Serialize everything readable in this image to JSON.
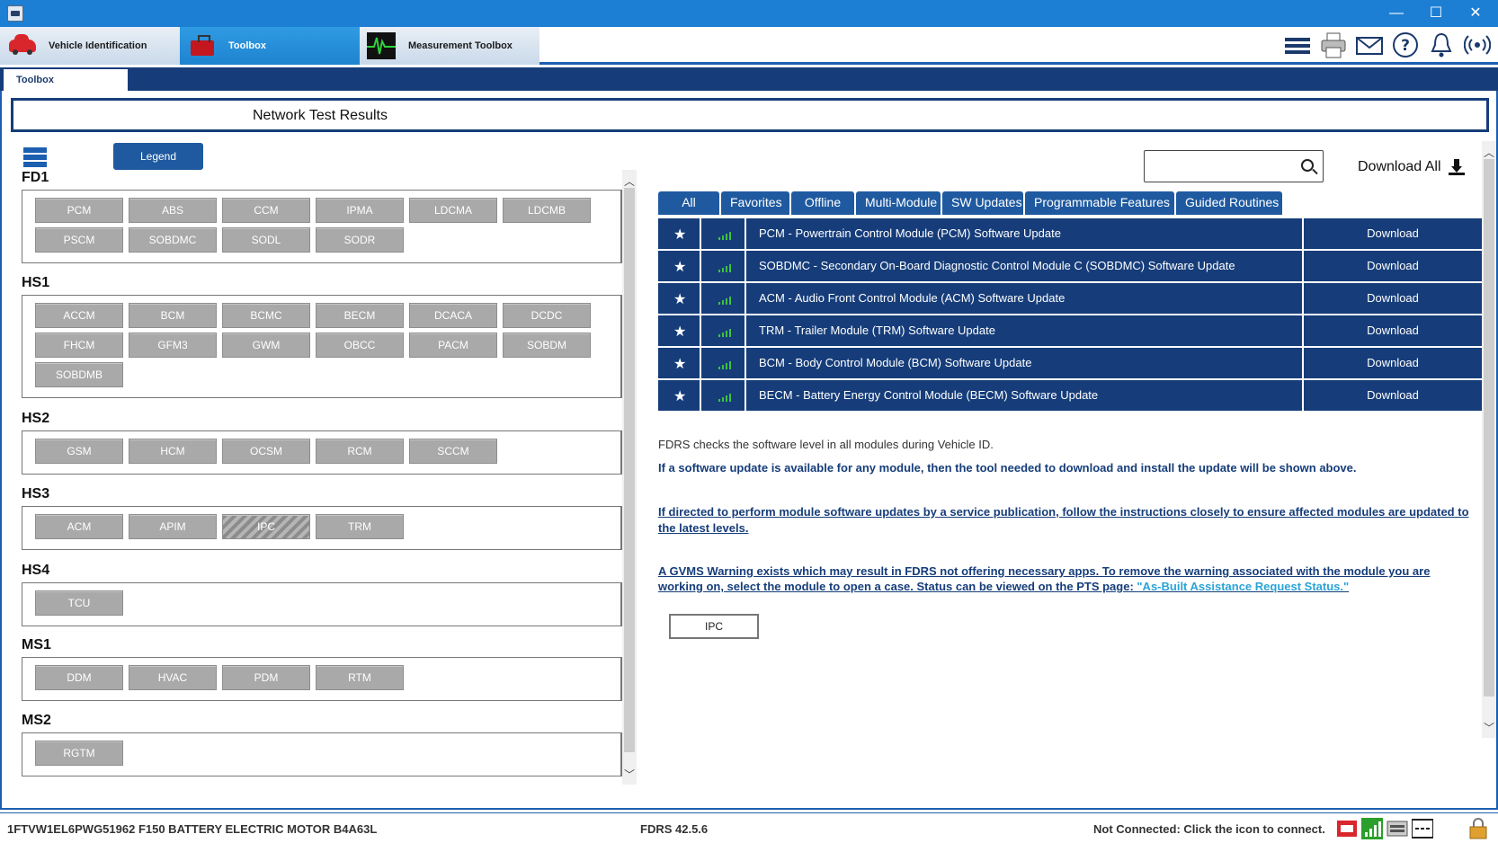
{
  "window": {
    "minimize": "—",
    "maximize": "☐",
    "close": "✕"
  },
  "top_tabs": [
    {
      "label": "Vehicle Identification"
    },
    {
      "label": "Toolbox"
    },
    {
      "label": "Measurement Toolbox"
    }
  ],
  "sub_tab": "Toolbox",
  "header_title": "Network Test Results",
  "legend_label": "Legend",
  "groups": [
    {
      "name": "FD1",
      "modules": [
        "PCM",
        "ABS",
        "CCM",
        "IPMA",
        "LDCMA",
        "LDCMB",
        "PSCM",
        "SOBDMC",
        "SODL",
        "SODR"
      ]
    },
    {
      "name": "HS1",
      "modules": [
        "ACCM",
        "BCM",
        "BCMC",
        "BECM",
        "DCACA",
        "DCDC",
        "FHCM",
        "GFM3",
        "GWM",
        "OBCC",
        "PACM",
        "SOBDM",
        "SOBDMB"
      ]
    },
    {
      "name": "HS2",
      "modules": [
        "GSM",
        "HCM",
        "OCSM",
        "RCM",
        "SCCM"
      ]
    },
    {
      "name": "HS3",
      "modules": [
        "ACM",
        "APIM",
        "IPC",
        "TRM"
      ]
    },
    {
      "name": "HS4",
      "modules": [
        "TCU"
      ]
    },
    {
      "name": "MS1",
      "modules": [
        "DDM",
        "HVAC",
        "PDM",
        "RTM"
      ]
    },
    {
      "name": "MS2",
      "modules": [
        "RGTM"
      ]
    }
  ],
  "search": {
    "placeholder": "",
    "value": ""
  },
  "download_all_label": "Download All",
  "filter_tabs": [
    "All",
    "Favorites",
    "Offline",
    "Multi-Module",
    "SW Updates",
    "Programmable Features",
    "Guided Routines"
  ],
  "results": [
    {
      "description": "PCM - Powertrain Control Module (PCM) Software Update",
      "action": "Download"
    },
    {
      "description": "SOBDMC - Secondary On-Board Diagnostic Control Module C (SOBDMC) Software Update",
      "action": "Download"
    },
    {
      "description": "ACM - Audio Front Control Module (ACM) Software Update",
      "action": "Download"
    },
    {
      "description": "TRM - Trailer Module (TRM) Software Update",
      "action": "Download"
    },
    {
      "description": "BCM - Body Control Module (BCM) Software Update",
      "action": "Download"
    },
    {
      "description": "BECM - Battery Energy Control Module (BECM) Software Update",
      "action": "Download"
    }
  ],
  "info": {
    "line1": "FDRS checks the software level in all modules during Vehicle ID.",
    "line2": "If a software update is available for any module, then the tool needed to download and install the update will be shown above.",
    "line3": "If directed to perform module software updates by a service publication, follow the instructions closely to ensure affected modules are updated to the latest levels.",
    "line4": "A GVMS Warning exists which may result in FDRS not offering necessary apps. To remove the warning associated with the module you are working on, select the module to open a case. Status can be viewed on the PTS page: ",
    "line4_link": "\"As-Built Assistance Request Status.\"",
    "ipc_button": "IPC"
  },
  "status": {
    "vin": "1FTVW1EL6PWG51962   F150 BATTERY ELECTRIC MOTOR B4A63L",
    "version": "FDRS 42.5.6",
    "connection": "Not Connected: Click the icon to connect."
  },
  "colors": {
    "titlebar": "#1c7fd4",
    "navy": "#163d7a",
    "tab_blue": "#1f5aa0",
    "module_grey": "#a9a9a9",
    "signal_green": "#3fc13f",
    "link_cyan": "#2aa3d6"
  }
}
